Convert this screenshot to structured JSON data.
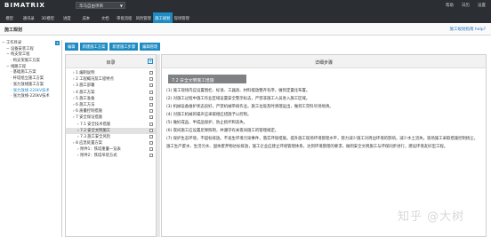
{
  "app": {
    "logo": "BIMATRIX",
    "project": "华马自由项目",
    "user_actions": [
      "帮助",
      "日历",
      "设置"
    ]
  },
  "menu": [
    "模型",
    "通讯录",
    "3D模型",
    "进度",
    "成本",
    "文档",
    "审批流程",
    "风险管理",
    "施工规划",
    "现场管理"
  ],
  "menu_active_index": 8,
  "page": {
    "title": "施工规划",
    "help_link": "施工规划指南 help?"
  },
  "tree": {
    "items": [
      {
        "label": "工作目录",
        "level": 0
      },
      {
        "label": "设备安装工程",
        "level": 1
      },
      {
        "label": "构支架工程",
        "level": 1
      },
      {
        "label": "构支架施工方案",
        "level": 2
      },
      {
        "label": "线路工程",
        "level": 1
      },
      {
        "label": "基础施工方案",
        "level": 2
      },
      {
        "label": "杆塔组立施工方案",
        "level": 2
      },
      {
        "label": "张力放线施工方案",
        "level": 2
      },
      {
        "label": "张力放线-220kV技术",
        "level": 2
      },
      {
        "label": "张力放线-220kV技术",
        "level": 2
      }
    ],
    "selected_index": 8,
    "add_icon": "plus-icon"
  },
  "toolbar": {
    "buttons": [
      "编辑",
      "新建施工方案",
      "新建施工步骤",
      "编辑管理"
    ]
  },
  "outline": {
    "header": "目录",
    "items": [
      {
        "label": "1 编制说明",
        "level": 0
      },
      {
        "label": "2 工程概况及工程特点",
        "level": 0
      },
      {
        "label": "3 施工部署",
        "level": 0
      },
      {
        "label": "4 施工方案",
        "level": 0
      },
      {
        "label": "5 施工准备",
        "level": 0
      },
      {
        "label": "6 施工方法",
        "level": 0
      },
      {
        "label": "6 质量控制措施",
        "level": 0
      },
      {
        "label": "7 安全保证措施",
        "level": 0
      },
      {
        "label": "7.1 安全技术措施",
        "level": 1
      },
      {
        "label": "7.2 安全文明施工",
        "level": 1
      },
      {
        "label": "7.3 施工安全风险",
        "level": 1
      },
      {
        "label": "8 应急处置方案",
        "level": 0
      },
      {
        "label": "附件1：铁塔重量一览表",
        "level": 1
      },
      {
        "label": "附件2：铁塔吊装方式",
        "level": 1
      }
    ],
    "selected_index": 9
  },
  "detail": {
    "header": "详细步骤",
    "title": "7.2 安全文明施工措施",
    "items": [
      "(1) 施工现场内应设置围栏、标语、工器具、材料摆放整齐有序，做到定置化布置。",
      "(2) 对施工过程中施工作业区域设置安全警示标志，严禁非施工人员进入施工区域。",
      "(3) 机械设备维护状态良好，严禁机械带病作业。施工垃圾及时清理运出，做到工完料尽场地清。",
      "(4) 对施工机械的噪声应采取相应措施予以控制。",
      "(5) 做好成品、半成品保护，防止损坏和丢失。",
      "(6) 夜间施工应设置足够照明，并遵守有关夜间施工的管理规定。",
      "(7) 保护生态环境，不超标排放。不发生环境污染事件，落实环保措施。提升施工现场环境管理水平，努力减少施工对周边环境的影响，减少水土流失。现场施工采取措施控制扬尘，施工生产废水、生活污水、固体废弃物达标排放，施工企业应建立环境管理体系，达到环境管理的要求，做到安全文明施工与环保同步进行，建设环境友好型工程。"
    ]
  },
  "watermark": "知乎 @大树"
}
